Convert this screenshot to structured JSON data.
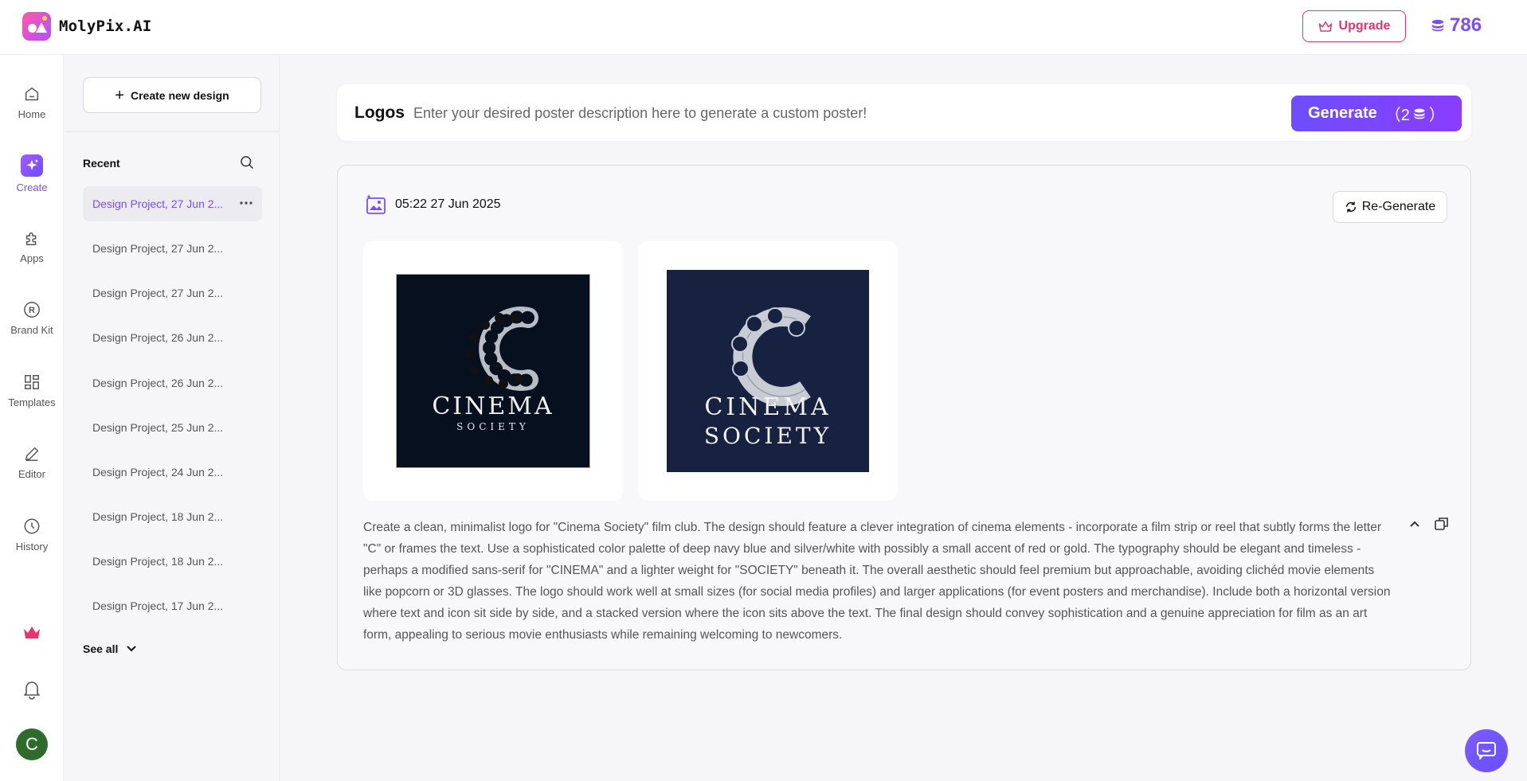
{
  "app": {
    "name": "MolyPix.AI"
  },
  "header": {
    "upgrade_label": "Upgrade",
    "credits": "786",
    "brand_color": "#7b4dff",
    "upgrade_color": "#e8336d"
  },
  "nav": {
    "items": [
      {
        "label": "Home",
        "icon": "home-icon"
      },
      {
        "label": "Create",
        "icon": "sparkle-icon",
        "active": true
      },
      {
        "label": "Apps",
        "icon": "puzzle-icon"
      },
      {
        "label": "Brand Kit",
        "icon": "registered-icon"
      },
      {
        "label": "Templates",
        "icon": "grid-icon"
      },
      {
        "label": "Editor",
        "icon": "pencil-icon"
      },
      {
        "label": "History",
        "icon": "clock-icon"
      }
    ],
    "avatar_initial": "C"
  },
  "panel": {
    "create_label": "Create new design",
    "recent_label": "Recent",
    "see_all_label": "See all",
    "items": [
      "Design Project, 27 Jun 2...",
      "Design Project, 27 Jun 2...",
      "Design Project, 27 Jun 2...",
      "Design Project, 26 Jun 2...",
      "Design Project, 26 Jun 2...",
      "Design Project, 25 Jun 2...",
      "Design Project, 24 Jun 2...",
      "Design Project, 18 Jun 2...",
      "Design Project, 18 Jun 2...",
      "Design Project, 17 Jun 2..."
    ]
  },
  "prompt": {
    "label": "Logos",
    "placeholder": "Enter your desired poster description here to generate a custom poster!",
    "generate_label": "Generate",
    "generate_cost": "（2",
    "generate_close": "）"
  },
  "result": {
    "timestamp": "05:22 27 Jun 2025",
    "regenerate_label": "Re-Generate",
    "images": [
      {
        "line1": "CINEMA",
        "line2": "SOCIETY"
      },
      {
        "line1": "CINEMA",
        "line2": "SOCIETY"
      }
    ],
    "description": "Create a clean, minimalist logo for \"Cinema Society\" film club. The design should feature a clever integration of cinema elements - incorporate a film strip or reel that subtly forms the letter \"C\" or frames the text. Use a sophisticated color palette of deep navy blue and silver/white with possibly a small accent of red or gold. The typography should be elegant and timeless - perhaps a modified sans-serif for \"CINEMA\" and a lighter weight for \"SOCIETY\" beneath it. The overall aesthetic should feel premium but approachable, avoiding clichéd movie elements like popcorn or 3D glasses. The logo should work well at small sizes (for social media profiles) and larger applications (for event posters and merchandise). Include both a horizontal version where text and icon sit side by side, and a stacked version where the icon sits above the text. The final design should convey sophistication and a genuine appreciation for film as an art form, appealing to serious movie enthusiasts while remaining welcoming to newcomers."
  }
}
